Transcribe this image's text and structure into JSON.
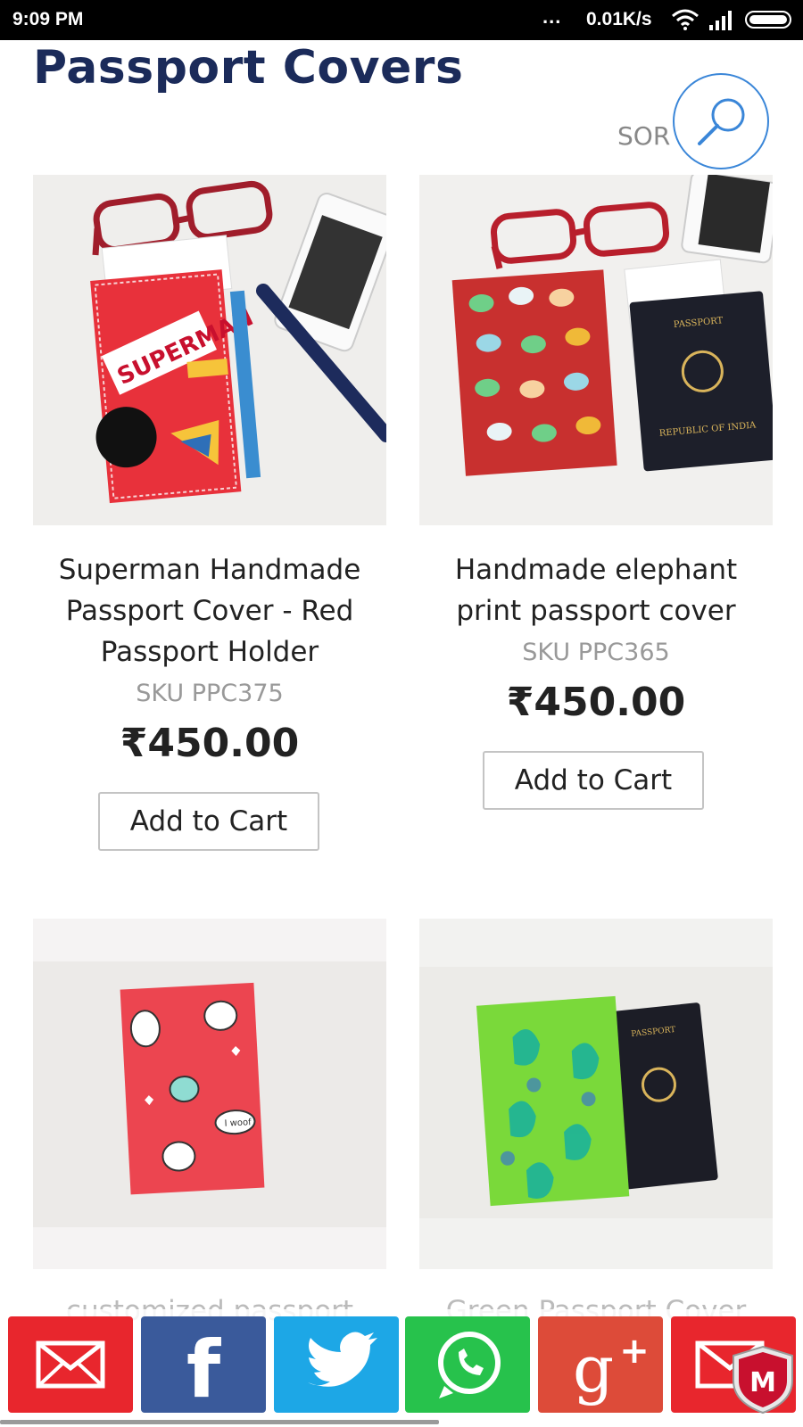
{
  "status_bar": {
    "time": "9:09 PM",
    "dots": "...",
    "network_speed": "0.01K/s"
  },
  "page": {
    "title": "Passport Covers",
    "sort_label": "SOR",
    "search_icon": "search-icon"
  },
  "products": [
    {
      "name_lines": [
        "Superman Handmade",
        "Passport Cover - Red",
        "Passport Holder"
      ],
      "sku": "SKU PPC375",
      "price": "₹450.00",
      "cta": "Add to Cart"
    },
    {
      "name_lines": [
        "Handmade elephant",
        "print passport cover"
      ],
      "sku": "SKU PPC365",
      "price": "₹450.00",
      "cta": "Add to Cart"
    },
    {
      "name_partial": "customized passport"
    },
    {
      "name_partial": "Green Passport Cover"
    }
  ],
  "share_bar": {
    "buttons": [
      {
        "icon": "email-icon",
        "color": "#e8262d"
      },
      {
        "icon": "facebook-icon",
        "color": "#3a5a9b"
      },
      {
        "icon": "twitter-icon",
        "color": "#1da7e6"
      },
      {
        "icon": "whatsapp-icon",
        "color": "#27c24c"
      },
      {
        "icon": "google-plus-icon",
        "color": "#dd4b39"
      },
      {
        "icon": "mail-icon",
        "color": "#e8262d"
      }
    ]
  }
}
